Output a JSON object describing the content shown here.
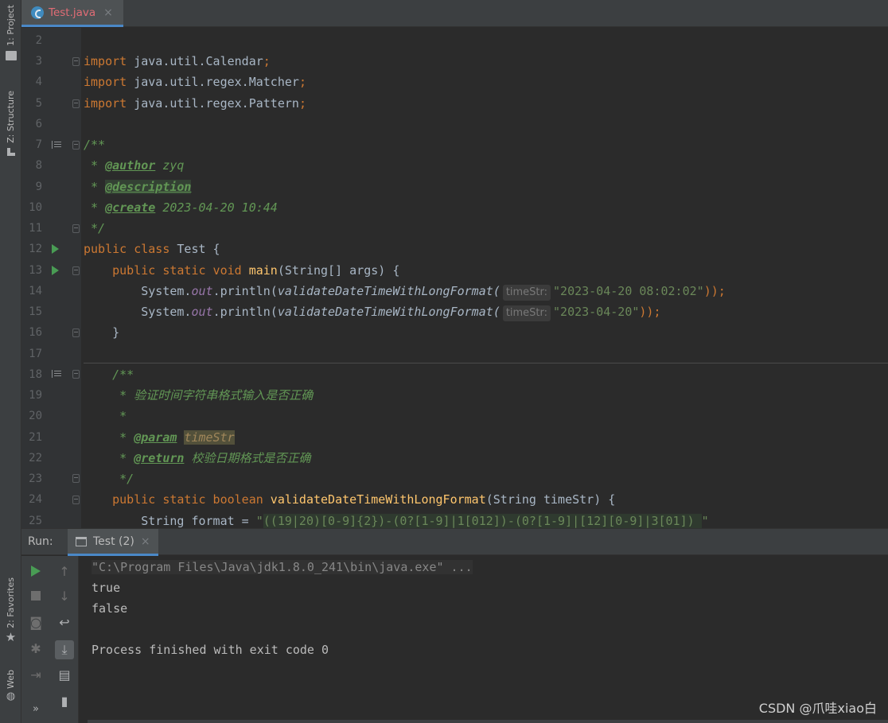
{
  "tool_windows": {
    "project": "1: Project",
    "structure": "Z: Structure",
    "favorites": "2: Favorites",
    "web": "Web"
  },
  "tabs": [
    {
      "label": "Test.java",
      "close": "×"
    }
  ],
  "editor": {
    "line_numbers": [
      "2",
      "3",
      "4",
      "5",
      "6",
      "7",
      "8",
      "9",
      "10",
      "11",
      "12",
      "13",
      "14",
      "15",
      "16",
      "17",
      "18",
      "19",
      "20",
      "21",
      "22",
      "23",
      "24",
      "25"
    ],
    "tokens": {
      "import": "import",
      "imp1": " java.util.Calendar",
      "imp2": " java.util.regex.Matcher",
      "imp3": " java.util.regex.Pattern",
      "semi": ";",
      "doc_open": "/**",
      "star": " * ",
      "author_tag": "@author",
      "author_val": " zyq",
      "desc_tag": "@description",
      "create_tag": "@create",
      "create_val": " 2023-04-20 10:44",
      "doc_close": " */",
      "public": "public",
      "class": " class",
      "class_name": " Test {",
      "static": " static",
      "void": " void",
      "main": " main",
      "main_args": "(String[] args) {",
      "system": "System.",
      "out": "out",
      "println": ".println(",
      "validate_call": "validateDateTimeWithLongFormat(",
      "hint_name": "timeStr:",
      "str1": "\"2023-04-20 08:02:02\"",
      "str2": "\"2023-04-20\"",
      "call_end": "));",
      "close_brace": "}",
      "doc2_open": "/**",
      "doc2_line1": " * 验证时间字符串格式输入是否正确",
      "doc2_blank": " *",
      "doc2_star": " * ",
      "param_tag": "@param",
      "param_name": "timeStr",
      "return_tag": "@return",
      "return_desc": " 校验日期格式是否正确",
      "doc2_close": " */",
      "boolean": " boolean",
      "validate_decl": " validateDateTimeWithLongFormat",
      "validate_args": "(String timeStr) {",
      "format_decl": "String format = ",
      "regex_q": "\"",
      "regex_body": "((19|20)[0-9]{2})-(0?[1-9]|1[012])-(0?[1-9]|[12][0-9]|3[01]) ",
      "regex_end": "\""
    }
  },
  "run_panel": {
    "label": "Run:",
    "tab_label": "Test (2)",
    "tab_close": "×",
    "console_lines": [
      "\"C:\\Program Files\\Java\\jdk1.8.0_241\\bin\\java.exe\" ...",
      "true",
      "false",
      "",
      "Process finished with exit code 0"
    ],
    "more": "»"
  },
  "watermark": "CSDN @爪哇xiao白",
  "colors": {
    "keyword": "#cc7832",
    "string": "#6a8759",
    "doc_comment": "#629755",
    "method": "#ffc66d",
    "static_field": "#9876aa",
    "run_green": "#499c54",
    "tab_accent": "#4a88c7"
  }
}
